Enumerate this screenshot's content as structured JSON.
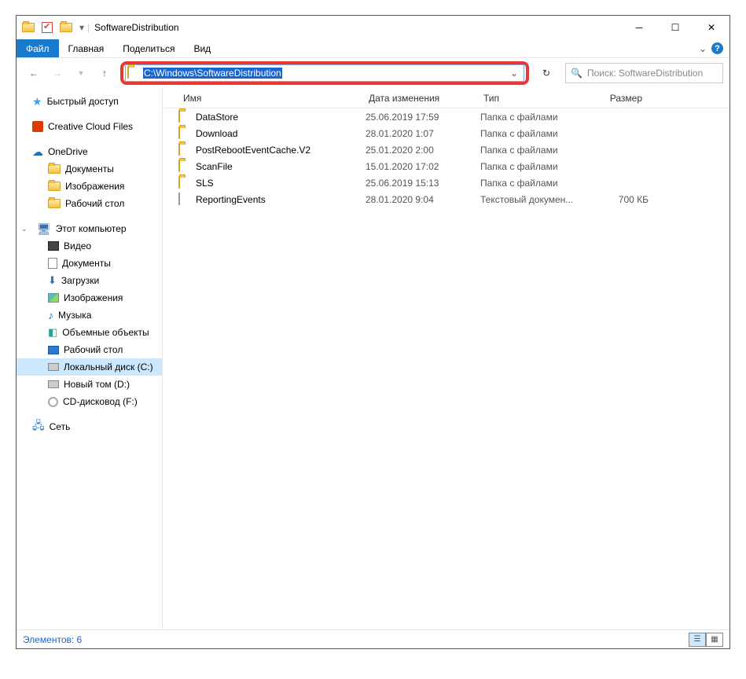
{
  "window": {
    "title": "SoftwareDistribution"
  },
  "ribbon": {
    "file": "Файл",
    "tabs": [
      "Главная",
      "Поделиться",
      "Вид"
    ]
  },
  "address": {
    "path": "C:\\Windows\\SoftwareDistribution"
  },
  "search": {
    "placeholder": "Поиск: SoftwareDistribution"
  },
  "columns": {
    "name": "Имя",
    "date": "Дата изменения",
    "type": "Тип",
    "size": "Размер"
  },
  "sidebar": {
    "quick": "Быстрый доступ",
    "cc": "Creative Cloud Files",
    "onedrive": "OneDrive",
    "od_children": [
      "Документы",
      "Изображения",
      "Рабочий стол"
    ],
    "pc": "Этот компьютер",
    "pc_children": [
      {
        "label": "Видео",
        "icon": "vid"
      },
      {
        "label": "Документы",
        "icon": "doc"
      },
      {
        "label": "Загрузки",
        "icon": "dl"
      },
      {
        "label": "Изображения",
        "icon": "img"
      },
      {
        "label": "Музыка",
        "icon": "mus"
      },
      {
        "label": "Объемные объекты",
        "icon": "3d"
      },
      {
        "label": "Рабочий стол",
        "icon": "desk"
      },
      {
        "label": "Локальный диск (C:)",
        "icon": "hdd",
        "sel": true
      },
      {
        "label": "Новый том (D:)",
        "icon": "hdd"
      },
      {
        "label": "CD-дисковод (F:)",
        "icon": "cd"
      }
    ],
    "net": "Сеть"
  },
  "files": [
    {
      "name": "DataStore",
      "date": "25.06.2019 17:59",
      "type": "Папка с файлами",
      "size": "",
      "icon": "folder"
    },
    {
      "name": "Download",
      "date": "28.01.2020 1:07",
      "type": "Папка с файлами",
      "size": "",
      "icon": "folder"
    },
    {
      "name": "PostRebootEventCache.V2",
      "date": "25.01.2020 2:00",
      "type": "Папка с файлами",
      "size": "",
      "icon": "folder"
    },
    {
      "name": "ScanFile",
      "date": "15.01.2020 17:02",
      "type": "Папка с файлами",
      "size": "",
      "icon": "folder"
    },
    {
      "name": "SLS",
      "date": "25.06.2019 15:13",
      "type": "Папка с файлами",
      "size": "",
      "icon": "folder"
    },
    {
      "name": "ReportingEvents",
      "date": "28.01.2020 9:04",
      "type": "Текстовый докумен...",
      "size": "700 КБ",
      "icon": "file"
    }
  ],
  "status": {
    "count": "Элементов: 6"
  }
}
